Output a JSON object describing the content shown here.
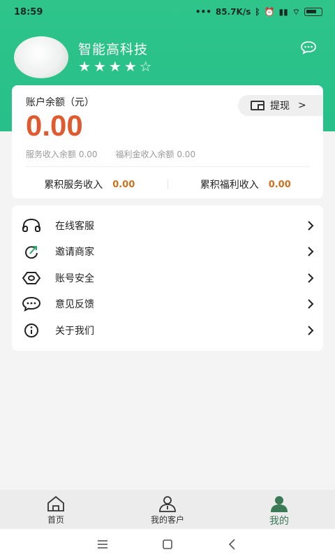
{
  "status": {
    "time": "18:59",
    "network_speed": "85.7K/s",
    "icons": [
      "dots-icon",
      "bluetooth-icon",
      "alarm-icon",
      "signal-icon",
      "wifi-icon",
      "battery-icon"
    ]
  },
  "profile": {
    "company_name": "智能高科技",
    "rating_stars": 4,
    "rating_max": 5
  },
  "balance": {
    "label": "账户余额（元）",
    "value": "0.00",
    "withdraw_label": "提现",
    "service_income_balance": "服务收入余额 0.00",
    "welfare_income_balance": "福利金收入余额 0.00",
    "total_service_label": "累积服务收入",
    "total_service_value": "0.00",
    "total_welfare_label": "累积福利收入",
    "total_welfare_value": "0.00"
  },
  "menu": {
    "items": [
      {
        "label": "在线客服",
        "icon": "headset-icon"
      },
      {
        "label": "邀请商家",
        "icon": "share-icon"
      },
      {
        "label": "账号安全",
        "icon": "shield-icon"
      },
      {
        "label": "意见反馈",
        "icon": "feedback-icon"
      },
      {
        "label": "关于我们",
        "icon": "info-icon"
      }
    ]
  },
  "tabbar": {
    "tabs": [
      {
        "label": "首页",
        "icon": "home-icon",
        "active": false
      },
      {
        "label": "我的客户",
        "icon": "customers-icon",
        "active": false
      },
      {
        "label": "我的",
        "icon": "profile-icon",
        "active": true
      }
    ]
  },
  "colors": {
    "brand_green": "#2ec48a",
    "balance_red": "#e05a2f",
    "amount_orange": "#c9721f",
    "active_tab": "#3b7a57"
  }
}
